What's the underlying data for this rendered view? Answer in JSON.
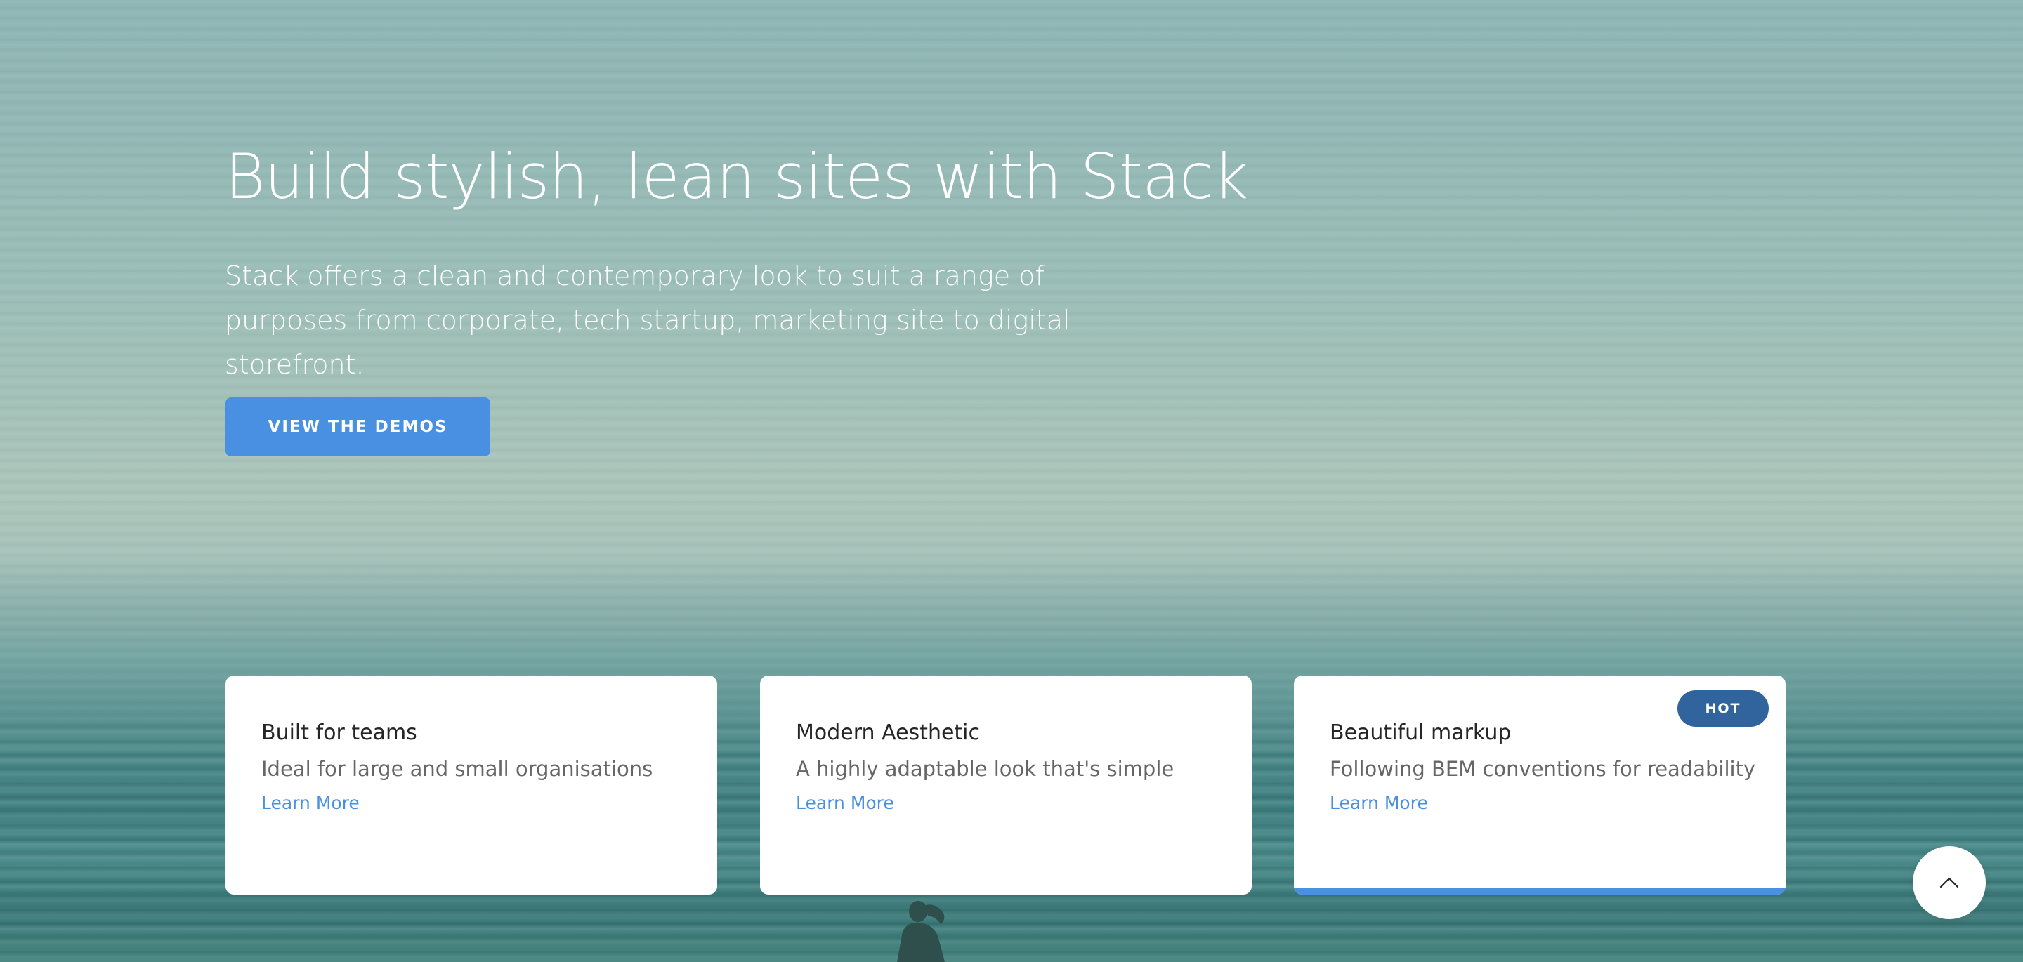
{
  "hero": {
    "title": "Build stylish, lean sites with Stack",
    "lead": "Stack offers a clean and contemporary look to suit a range of purposes from corporate, tech startup, marketing site to digital storefront.",
    "button_label": "VIEW THE DEMOS"
  },
  "features": [
    {
      "title": "Built for teams",
      "text": "Ideal for large and small organisations",
      "link": "Learn More"
    },
    {
      "title": "Modern Aesthetic",
      "text": "A highly adaptable look that's simple",
      "link": "Learn More"
    },
    {
      "title": "Beautiful markup",
      "text": "Following BEM conventions for readability",
      "link": "Learn More",
      "badge": "HOT"
    }
  ],
  "back_to_top_icon": "chevron-up-icon",
  "colors": {
    "accent": "#4a90e2",
    "badge": "#31639c",
    "card_bg": "#ffffff",
    "card_title": "#252525",
    "card_text": "#666666"
  }
}
